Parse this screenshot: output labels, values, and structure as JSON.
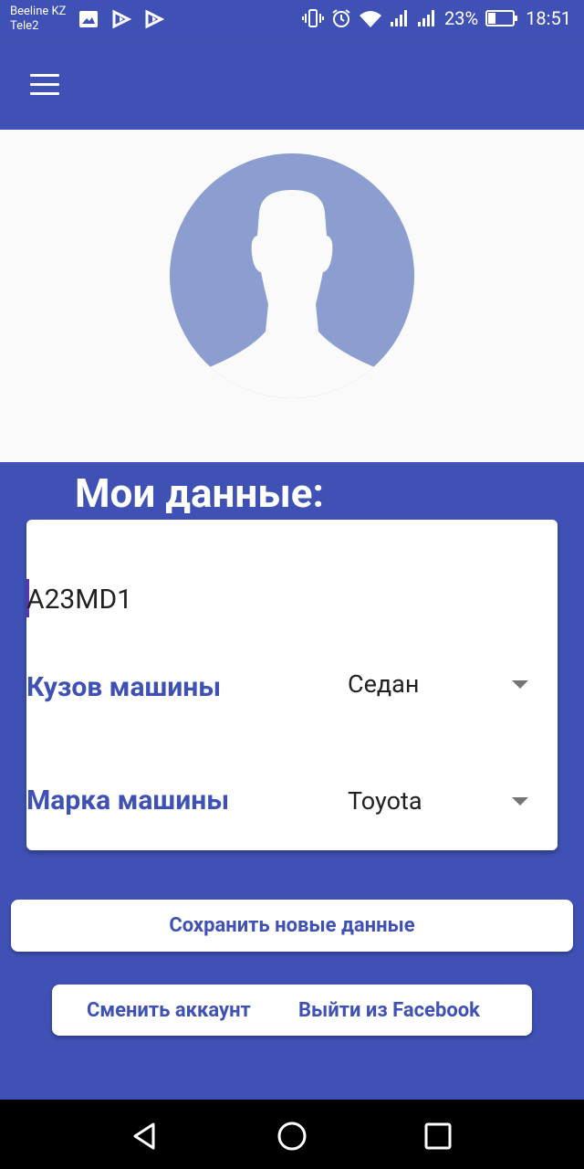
{
  "status_bar": {
    "carrier_1": "Beeline KZ",
    "carrier_2": "Tele2",
    "battery": "23%",
    "time": "18:51"
  },
  "profile": {
    "section_title": "Мои данные:",
    "plate_number": "A23MD1",
    "body_label": "Кузов машины",
    "body_value": "Седан",
    "brand_label": "Марка машины",
    "brand_value": "Toyota"
  },
  "actions": {
    "save": "Сохранить новые данные",
    "switch_account": "Сменить аккаунт",
    "logout_facebook": "Выйти из Facebook"
  },
  "colors": {
    "primary": "#3f51b5",
    "avatar": "#8c9ecf"
  }
}
